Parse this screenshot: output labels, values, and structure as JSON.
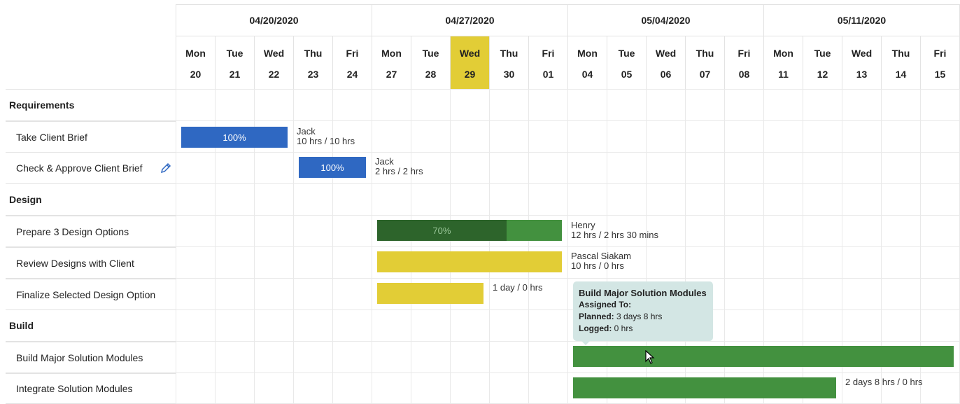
{
  "weeks": [
    "04/20/2020",
    "04/27/2020",
    "05/04/2020",
    "05/11/2020"
  ],
  "days": [
    {
      "name": "Mon",
      "num": "20"
    },
    {
      "name": "Tue",
      "num": "21"
    },
    {
      "name": "Wed",
      "num": "22"
    },
    {
      "name": "Thu",
      "num": "23"
    },
    {
      "name": "Fri",
      "num": "24"
    },
    {
      "name": "Mon",
      "num": "27"
    },
    {
      "name": "Tue",
      "num": "28"
    },
    {
      "name": "Wed",
      "num": "29"
    },
    {
      "name": "Thu",
      "num": "30"
    },
    {
      "name": "Fri",
      "num": "01"
    },
    {
      "name": "Mon",
      "num": "04"
    },
    {
      "name": "Tue",
      "num": "05"
    },
    {
      "name": "Wed",
      "num": "06"
    },
    {
      "name": "Thu",
      "num": "07"
    },
    {
      "name": "Fri",
      "num": "08"
    },
    {
      "name": "Mon",
      "num": "11"
    },
    {
      "name": "Tue",
      "num": "12"
    },
    {
      "name": "Wed",
      "num": "13"
    },
    {
      "name": "Thu",
      "num": "14"
    },
    {
      "name": "Fri",
      "num": "15"
    }
  ],
  "today_color": "#e2cd36",
  "rows": [
    {
      "type": "group",
      "label": "Requirements"
    },
    {
      "type": "task",
      "label": "Take Client Brief"
    },
    {
      "type": "task",
      "label": "Check & Approve Client Brief",
      "icon": "pencil-icon"
    },
    {
      "type": "group",
      "label": "Design"
    },
    {
      "type": "task",
      "label": "Prepare 3 Design Options"
    },
    {
      "type": "task",
      "label": "Review Designs with Client"
    },
    {
      "type": "task",
      "label": "Finalize Selected Design Option"
    },
    {
      "type": "group",
      "label": "Build"
    },
    {
      "type": "task",
      "label": "Build Major Solution Modules"
    },
    {
      "type": "task",
      "label": "Integrate Solution Modules"
    }
  ],
  "bars": {
    "take_client_brief": {
      "progress": "100%",
      "assignee": "Jack",
      "hours": "10 hrs / 10 hrs"
    },
    "check_approve": {
      "progress": "100%",
      "assignee": "Jack",
      "hours": "2 hrs / 2 hrs"
    },
    "prepare_options": {
      "progress": "70%",
      "progress_fraction": 0.7,
      "assignee": "Henry",
      "hours": "12 hrs / 2 hrs 30 mins"
    },
    "review_designs": {
      "assignee": "Pascal Siakam",
      "hours": "10 hrs / 0 hrs"
    },
    "finalize_option": {
      "hours": "1 day / 0 hrs"
    },
    "integrate_modules": {
      "hours": "2 days 8 hrs / 0 hrs"
    }
  },
  "tooltip": {
    "title": "Build Major Solution Modules",
    "assigned_label": "Assigned To:",
    "planned_label": "Planned:",
    "planned_value": "3 days 8 hrs",
    "logged_label": "Logged:",
    "logged_value": "0 hrs"
  },
  "colors": {
    "blue": "#2f68c2",
    "green": "#43913f",
    "dark_green": "#2d642b",
    "yellow": "#e2cd36",
    "tooltip": "#d3e6e4"
  }
}
